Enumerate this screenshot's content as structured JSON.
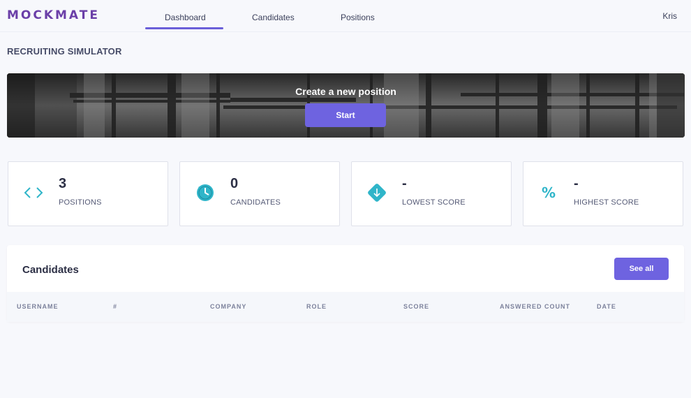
{
  "app": {
    "logo": "MOCKMATE",
    "user": "Kris"
  },
  "nav": {
    "tabs": [
      {
        "label": "Dashboard",
        "active": true
      },
      {
        "label": "Candidates",
        "active": false
      },
      {
        "label": "Positions",
        "active": false
      }
    ]
  },
  "page": {
    "title": "RECRUITING SIMULATOR"
  },
  "banner": {
    "title": "Create a new position",
    "button_label": "Start"
  },
  "stats": [
    {
      "icon": "code-brackets-icon",
      "value": "3",
      "label": "POSITIONS",
      "color": "#2fb5c9"
    },
    {
      "icon": "clock-icon",
      "value": "0",
      "label": "CANDIDATES",
      "color": "#2fb5c9"
    },
    {
      "icon": "arrow-down-diamond-icon",
      "value": "-",
      "label": "LOWEST SCORE",
      "color": "#2fb5c9"
    },
    {
      "icon": "percent-icon",
      "value": "-",
      "label": "HIGHEST SCORE",
      "color": "#2fb5c9"
    }
  ],
  "candidates": {
    "title": "Candidates",
    "see_all_label": "See all",
    "columns": [
      "USERNAME",
      "#",
      "COMPANY",
      "ROLE",
      "SCORE",
      "ANSWERED COUNT",
      "DATE"
    ],
    "rows": []
  },
  "colors": {
    "accent": "#6e63e0",
    "logo": "#6b3fa8",
    "teal": "#2fb5c9"
  }
}
